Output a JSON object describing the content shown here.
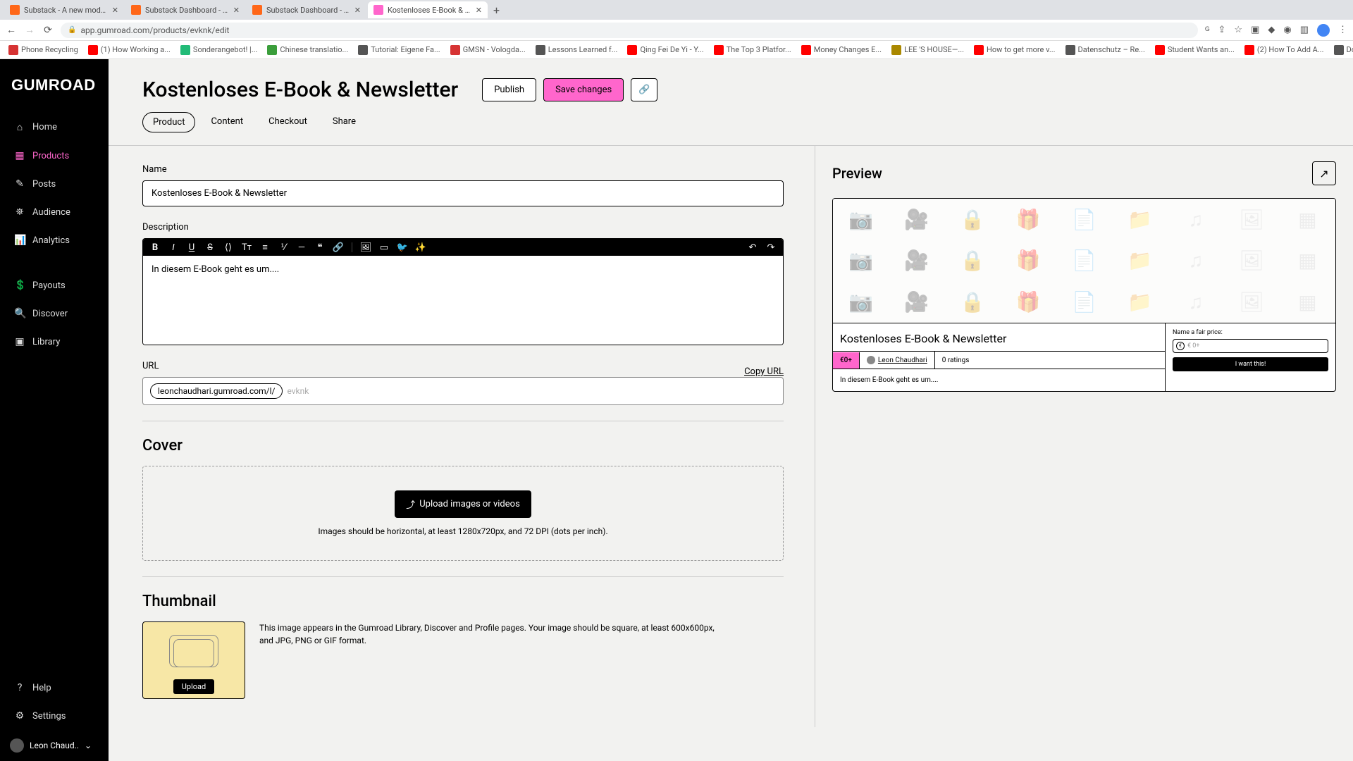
{
  "browser": {
    "tabs": [
      {
        "title": "Substack - A new model for p...",
        "favicon": "#ff6719"
      },
      {
        "title": "Substack Dashboard - Leon's",
        "favicon": "#ff6719"
      },
      {
        "title": "Substack Dashboard - Leon's",
        "favicon": "#ff6719"
      },
      {
        "title": "Kostenloses E-Book & Newslet",
        "favicon": "#ff66cc",
        "active": true
      }
    ],
    "url": "app.gumroad.com/products/evknk/edit",
    "bookmarks": [
      {
        "label": "Phone Recycling",
        "color": "#d63333"
      },
      {
        "label": "(1) How Working a...",
        "color": "#ff0000"
      },
      {
        "label": "Sonderangebot! |...",
        "color": "#2b7"
      },
      {
        "label": "Chinese translatio...",
        "color": "#3b9e3b"
      },
      {
        "label": "Tutorial: Eigene Fa...",
        "color": "#555"
      },
      {
        "label": "GMSN - Vologda...",
        "color": "#d63333"
      },
      {
        "label": "Lessons Learned f...",
        "color": "#555"
      },
      {
        "label": "Qing Fei De Yi - Y...",
        "color": "#ff0000"
      },
      {
        "label": "The Top 3 Platfor...",
        "color": "#ff0000"
      },
      {
        "label": "Money Changes E...",
        "color": "#ff0000"
      },
      {
        "label": "LEE 'S HOUSE—...",
        "color": "#a80"
      },
      {
        "label": "How to get more v...",
        "color": "#ff0000"
      },
      {
        "label": "Datenschutz – Re...",
        "color": "#555"
      },
      {
        "label": "Student Wants an...",
        "color": "#ff0000"
      },
      {
        "label": "(2) How To Add A...",
        "color": "#ff0000"
      },
      {
        "label": "Download – Cooki...",
        "color": "#555"
      }
    ]
  },
  "sidebar": {
    "logo": "GUMROAD",
    "items": [
      {
        "label": "Home",
        "icon": "⌂"
      },
      {
        "label": "Products",
        "icon": "▦",
        "active": true
      },
      {
        "label": "Posts",
        "icon": "✎"
      },
      {
        "label": "Audience",
        "icon": "⛯"
      },
      {
        "label": "Analytics",
        "icon": "📊"
      },
      {
        "label": "Payouts",
        "icon": "💲"
      },
      {
        "label": "Discover",
        "icon": "🔍"
      },
      {
        "label": "Library",
        "icon": "▣"
      }
    ],
    "bottom": [
      {
        "label": "Help",
        "icon": "?"
      },
      {
        "label": "Settings",
        "icon": "⚙"
      }
    ],
    "user": "Leon Chaud.."
  },
  "header": {
    "title": "Kostenloses E-Book & Newsletter",
    "publish": "Publish",
    "save": "Save changes"
  },
  "tabs": {
    "items": [
      {
        "label": "Product",
        "active": true
      },
      {
        "label": "Content"
      },
      {
        "label": "Checkout"
      },
      {
        "label": "Share"
      }
    ]
  },
  "form": {
    "name_label": "Name",
    "name_value": "Kostenloses E-Book & Newsletter",
    "desc_label": "Description",
    "desc_value": "In diesem E-Book geht es um....",
    "url_label": "URL",
    "copy_label": "Copy URL",
    "url_prefix": "leonchaudhari.gumroad.com/l/",
    "url_slug": "evknk",
    "cover_title": "Cover",
    "upload_label": "Upload images or videos",
    "upload_hint": "Images should be horizontal, at least 1280x720px, and 72 DPI (dots per inch).",
    "thumb_title": "Thumbnail",
    "thumb_upload": "Upload",
    "thumb_hint": "This image appears in the Gumroad Library, Discover and Profile pages. Your image should be square, at least 600x600px, and JPG, PNG or GIF format."
  },
  "preview": {
    "title": "Preview",
    "product_title": "Kostenloses E-Book & Newsletter",
    "price": "€0+",
    "author": "Leon Chaudhari",
    "ratings": "0 ratings",
    "desc": "In diesem E-Book geht es um....",
    "price_label": "Name a fair price:",
    "price_placeholder": "€ 0+",
    "cta": "I want this!"
  }
}
